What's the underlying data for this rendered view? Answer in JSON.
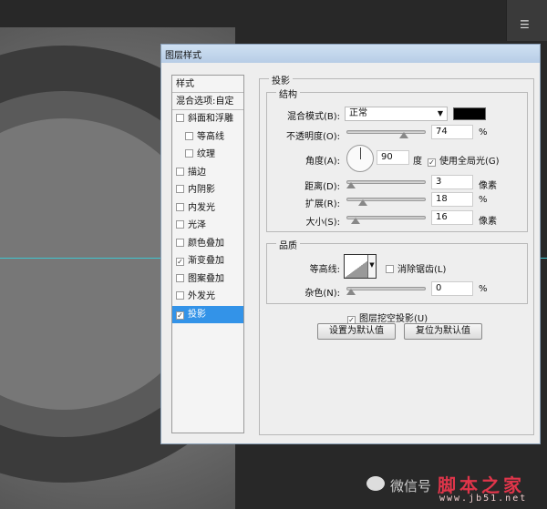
{
  "dialog": {
    "title": "图层样式"
  },
  "styles": {
    "header": "样式",
    "blend_options": "混合选项:自定",
    "items": [
      {
        "label": "斜面和浮雕",
        "checked": false
      },
      {
        "label": "等高线",
        "checked": false
      },
      {
        "label": "纹理",
        "checked": false
      },
      {
        "label": "描边",
        "checked": false
      },
      {
        "label": "内阴影",
        "checked": false
      },
      {
        "label": "内发光",
        "checked": false
      },
      {
        "label": "光泽",
        "checked": false
      },
      {
        "label": "颜色叠加",
        "checked": false
      },
      {
        "label": "渐变叠加",
        "checked": true
      },
      {
        "label": "图案叠加",
        "checked": false
      },
      {
        "label": "外发光",
        "checked": false
      },
      {
        "label": "投影",
        "checked": true,
        "selected": true
      }
    ]
  },
  "drop_shadow": {
    "title": "投影",
    "structure": {
      "title": "结构",
      "blend_mode_label": "混合模式(B):",
      "blend_mode": "正常",
      "shadow_color": "#000000",
      "opacity_label": "不透明度(O):",
      "opacity": "74",
      "opacity_unit": "%",
      "angle_label": "角度(A):",
      "angle": "90",
      "angle_unit": "度",
      "global_light_label": "使用全局光(G)",
      "global_light": true,
      "distance_label": "距离(D):",
      "distance": "3",
      "distance_unit": "像素",
      "spread_label": "扩展(R):",
      "spread": "18",
      "spread_unit": "%",
      "size_label": "大小(S):",
      "size": "16",
      "size_unit": "像素"
    },
    "quality": {
      "title": "品质",
      "contour_label": "等高线:",
      "antialias_label": "消除锯齿(L)",
      "antialias": false,
      "noise_label": "杂色(N):",
      "noise": "0",
      "noise_unit": "%"
    },
    "knockout_label": "图层挖空投影(U)",
    "knockout": true,
    "make_default": "设置为默认值",
    "reset_default": "复位为默认值"
  },
  "watermark": {
    "text": "微信号",
    "logo": "脚本之家",
    "url": "www.jb51.net"
  }
}
